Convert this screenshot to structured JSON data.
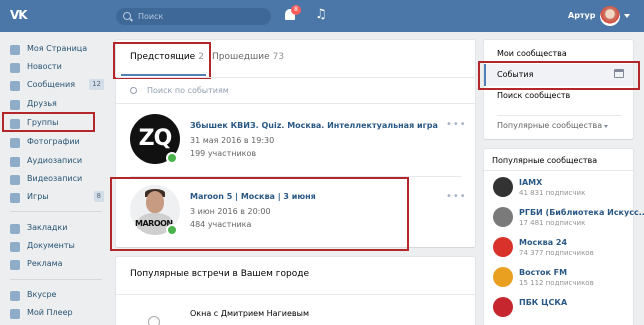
{
  "header": {
    "logo": "VK",
    "search_placeholder": "Поиск",
    "notifications_count": "8",
    "user_name": "Артур"
  },
  "nav": {
    "items": [
      {
        "label": "Моя Страница",
        "icon": "home-icon"
      },
      {
        "label": "Новости",
        "icon": "news-icon"
      },
      {
        "label": "Сообщения",
        "icon": "messages-icon",
        "count": "12"
      },
      {
        "label": "Друзья",
        "icon": "friends-icon"
      },
      {
        "label": "Группы",
        "icon": "groups-icon"
      },
      {
        "label": "Фотографии",
        "icon": "photos-icon"
      },
      {
        "label": "Аудиозаписи",
        "icon": "audio-icon"
      },
      {
        "label": "Видеозаписи",
        "icon": "video-icon"
      },
      {
        "label": "Игры",
        "icon": "games-icon",
        "count": "8"
      }
    ],
    "items2": [
      {
        "label": "Закладки",
        "icon": "bookmarks-icon"
      },
      {
        "label": "Документы",
        "icon": "documents-icon"
      },
      {
        "label": "Реклама",
        "icon": "ads-icon"
      }
    ],
    "items3": [
      {
        "label": "Вкусре",
        "icon": "app-icon"
      },
      {
        "label": "Мой Плеер",
        "icon": "player-icon"
      }
    ]
  },
  "tabs": {
    "upcoming_label": "Предстоящие",
    "upcoming_count": "2",
    "past_label": "Прошедшие",
    "past_count": "73"
  },
  "search_events_placeholder": "Поиск по событиям",
  "events": [
    {
      "photo_text": "ZQ",
      "title": "Збышек КВИЗ. Quiz. Москва. Интеллектуальная игра",
      "date": "31 мая 2016 в 19:30",
      "participants": "199 участников",
      "menu": "•••"
    },
    {
      "photo_text": "MAROON",
      "title": "Maroon 5 | Москва | 3 июня",
      "date": "3 июн 2016 в 20:00",
      "participants": "484 участника",
      "menu": "•••"
    }
  ],
  "popular": {
    "title": "Популярные встречи в Вашем городе",
    "first_event": "Окна с Дмитрием Нагиевым"
  },
  "right_menu": {
    "my_communities": "Мои сообщества",
    "events": "События",
    "search_communities": "Поиск сообществ",
    "popular_communities": "Популярные сообщества"
  },
  "popular_communities": {
    "title": "Популярные сообщества",
    "items": [
      {
        "name": "IAMX",
        "subs": "41 831 подписчик",
        "color": "#333333"
      },
      {
        "name": "РГБИ (Библиотека Искусс...",
        "subs": "17 481 подписчик",
        "color": "#7a7a7a"
      },
      {
        "name": "Москва 24",
        "subs": "74 377 подписчиков",
        "color": "#d8322a"
      },
      {
        "name": "Восток FM",
        "subs": "15 112 подписчиков",
        "color": "#e9a021"
      },
      {
        "name": "ПБК ЦСКА",
        "subs": "",
        "color": "#c6262e"
      }
    ]
  },
  "colors": {
    "header": "#4a76a8",
    "accent": "#5181b8",
    "link": "#2a5885",
    "highlight": "#b3262a"
  }
}
